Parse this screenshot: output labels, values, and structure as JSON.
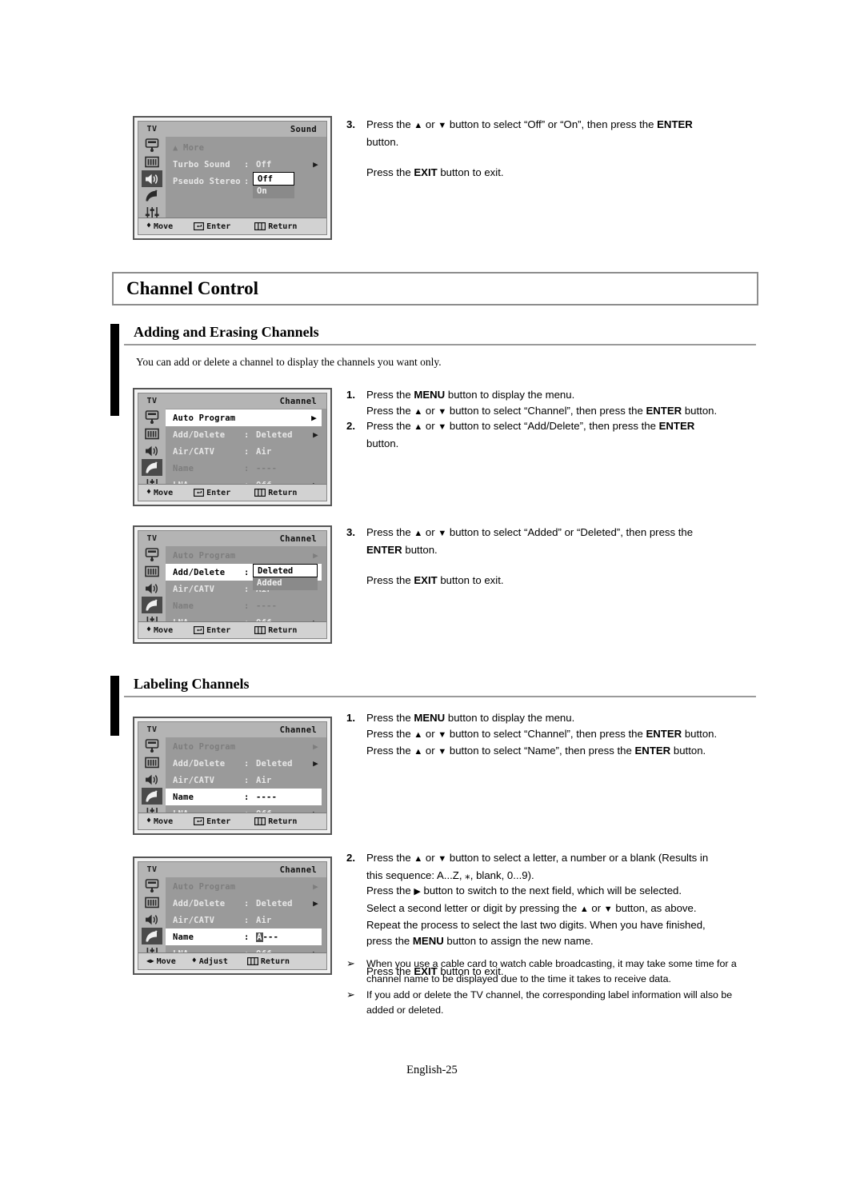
{
  "page": {
    "footer": "English-25"
  },
  "chapter": {
    "title": "Channel Control"
  },
  "sections": [
    {
      "heading": "Adding and Erasing Channels",
      "intro": "You can add or delete a channel to display the channels you want only."
    },
    {
      "heading": "Labeling Channels"
    }
  ],
  "osd_sound": {
    "tv_label": "TV",
    "title": "Sound",
    "rows": [
      {
        "label": "▲ More",
        "colon": "",
        "value": "",
        "arrow": ""
      },
      {
        "label": "Turbo Sound",
        "colon": ":",
        "value": "Off",
        "arrow": "▶"
      },
      {
        "label": "Pseudo Stereo",
        "colon": ":",
        "value": "",
        "arrow": ""
      }
    ],
    "dropdown": {
      "selected": "Off",
      "other": "On"
    },
    "footer": {
      "move": "Move",
      "enter": "Enter",
      "return": "Return"
    },
    "icons": [
      "picture-icon",
      "bars-icon",
      "speaker-icon",
      "satellite-icon",
      "sliders-icon"
    ],
    "selected_icon": "speaker-icon"
  },
  "osd_channel_1": {
    "tv_label": "TV",
    "title": "Channel",
    "rows": [
      {
        "label": "Auto Program",
        "colon": "",
        "value": "",
        "arrow": "▶",
        "state": "highlight"
      },
      {
        "label": "Add/Delete",
        "colon": ":",
        "value": "Deleted",
        "arrow": "▶",
        "state": "normal"
      },
      {
        "label": "Air/CATV",
        "colon": ":",
        "value": "Air",
        "arrow": "",
        "state": "normal"
      },
      {
        "label": "Name",
        "colon": ":",
        "value": "----",
        "arrow": "",
        "state": "normal"
      },
      {
        "label": "LNA",
        "colon": ":",
        "value": "Off",
        "arrow": "▶",
        "state": "normal"
      }
    ],
    "footer": {
      "move": "Move",
      "enter": "Enter",
      "return": "Return"
    },
    "selected_icon": "satellite-icon"
  },
  "osd_channel_2": {
    "tv_label": "TV",
    "title": "Channel",
    "rows": [
      {
        "label": "Auto Program",
        "colon": "",
        "value": "",
        "arrow": "▶",
        "state": "dim"
      },
      {
        "label": "Add/Delete",
        "colon": ":",
        "value": "",
        "arrow": "",
        "state": "highlight"
      },
      {
        "label": "Air/CATV",
        "colon": ":",
        "value": "Air",
        "arrow": "",
        "state": "normal"
      },
      {
        "label": "Name",
        "colon": ":",
        "value": "----",
        "arrow": "",
        "state": "dim"
      },
      {
        "label": "LNA",
        "colon": ":",
        "value": "Off",
        "arrow": "▶",
        "state": "normal"
      }
    ],
    "dropdown": {
      "selected": "Deleted",
      "other": "Added"
    },
    "footer": {
      "move": "Move",
      "enter": "Enter",
      "return": "Return"
    },
    "selected_icon": "satellite-icon"
  },
  "osd_channel_3": {
    "tv_label": "TV",
    "title": "Channel",
    "rows": [
      {
        "label": "Auto Program",
        "colon": "",
        "value": "",
        "arrow": "▶",
        "state": "dim"
      },
      {
        "label": "Add/Delete",
        "colon": ":",
        "value": "Deleted",
        "arrow": "▶",
        "state": "normal"
      },
      {
        "label": "Air/CATV",
        "colon": ":",
        "value": "Air",
        "arrow": "",
        "state": "normal"
      },
      {
        "label": "Name",
        "colon": ":",
        "value": "----",
        "arrow": "",
        "state": "highlight"
      },
      {
        "label": "LNA",
        "colon": ":",
        "value": "Off",
        "arrow": "▶",
        "state": "normal"
      }
    ],
    "footer": {
      "move": "Move",
      "enter": "Enter",
      "return": "Return"
    },
    "selected_icon": "satellite-icon"
  },
  "osd_channel_4": {
    "tv_label": "TV",
    "title": "Channel",
    "rows": [
      {
        "label": "Auto Program",
        "colon": "",
        "value": "",
        "arrow": "▶",
        "state": "dim"
      },
      {
        "label": "Add/Delete",
        "colon": ":",
        "value": "Deleted",
        "arrow": "▶",
        "state": "normal"
      },
      {
        "label": "Air/CATV",
        "colon": ":",
        "value": "Air",
        "arrow": "",
        "state": "normal"
      },
      {
        "label": "Name",
        "colon": ":",
        "value": "A---",
        "arrow": "",
        "state": "highlight-name"
      },
      {
        "label": "LNA",
        "colon": ":",
        "value": "Off",
        "arrow": "▶",
        "state": "normal"
      }
    ],
    "name_cursor_char": "A",
    "name_rest": "---",
    "footer": {
      "move": "Move",
      "adjust": "Adjust",
      "return": "Return"
    },
    "selected_icon": "satellite-icon"
  },
  "steps": {
    "sound_3": {
      "num": "3.",
      "line1_a": "Press the ",
      "line1_b": " or ",
      "line1_c": " button to select “Off” or “On”, then press the ",
      "line1_bold": "ENTER",
      "line2": "button.",
      "exit_a": "Press the ",
      "exit_bold": "EXIT",
      "exit_b": " button to exit."
    },
    "add_1": {
      "num": "1.",
      "l1_a": "Press the ",
      "l1_bold": "MENU",
      "l1_b": " button to display the menu.",
      "l2_a": "Press the ",
      "l2_b": " or ",
      "l2_c": " button to select “Channel”, then press the ",
      "l2_bold": "ENTER",
      "l2_d": " button."
    },
    "add_2": {
      "num": "2.",
      "l1_a": "Press the ",
      "l1_b": " or ",
      "l1_c": " button to select “Add/Delete”, then press the ",
      "l1_bold": "ENTER",
      "l2": "button."
    },
    "add_3": {
      "num": "3.",
      "l1_a": "Press the ",
      "l1_b": " or ",
      "l1_c": " button to select “Added” or “Deleted”, then press the ",
      "l2_bold": "ENTER",
      "l2_b": " button.",
      "exit_a": "Press the ",
      "exit_bold": "EXIT",
      "exit_b": " button to exit."
    },
    "label_1": {
      "num": "1.",
      "l1_a": "Press the ",
      "l1_bold": "MENU",
      "l1_b": " button to display the menu.",
      "l2_a": "Press the ",
      "l2_b": " or ",
      "l2_c": " button to select “Channel”, then press the ",
      "l2_bold": "ENTER",
      "l2_d": " button.",
      "l3_a": "Press the ",
      "l3_b": " or ",
      "l3_c": " button to select “Name”, then press the ",
      "l3_bold": "ENTER",
      "l3_d": " button."
    },
    "label_2": {
      "num": "2.",
      "l1_a": "Press the ",
      "l1_b": " or ",
      "l1_c": " button to select a letter, a number or a blank (Results in",
      "l2": "this sequence: A...Z, ⁎, blank, 0...9).",
      "l3_a": "Press the ",
      "l3_b": " button to switch to the next field, which will be selected.",
      "l4_a": "Select a second letter or digit by pressing the ",
      "l4_b": " or ",
      "l4_c": " button, as above.",
      "l5": "Repeat the process to select the last two digits. When you have finished,",
      "l6_a": "press the ",
      "l6_bold": "MENU",
      "l6_b": " button to assign the new name.",
      "exit_a": "Press the ",
      "exit_bold": "EXIT",
      "exit_b": " button to exit."
    }
  },
  "notes": [
    {
      "bullet": "➢",
      "line1": "When you use a cable card to watch cable broadcasting, it may take some time for a",
      "line2": "channel name to be displayed due to the time it takes to receive data."
    },
    {
      "bullet": "➢",
      "line1": "If you add or delete the TV channel, the corresponding label information will also be",
      "line2": "added or deleted."
    }
  ],
  "glyphs": {
    "up_triangle": "▲",
    "down_triangle": "▼",
    "right_triangle": "▶",
    "updown": "♦",
    "leftright": "◀▶"
  }
}
